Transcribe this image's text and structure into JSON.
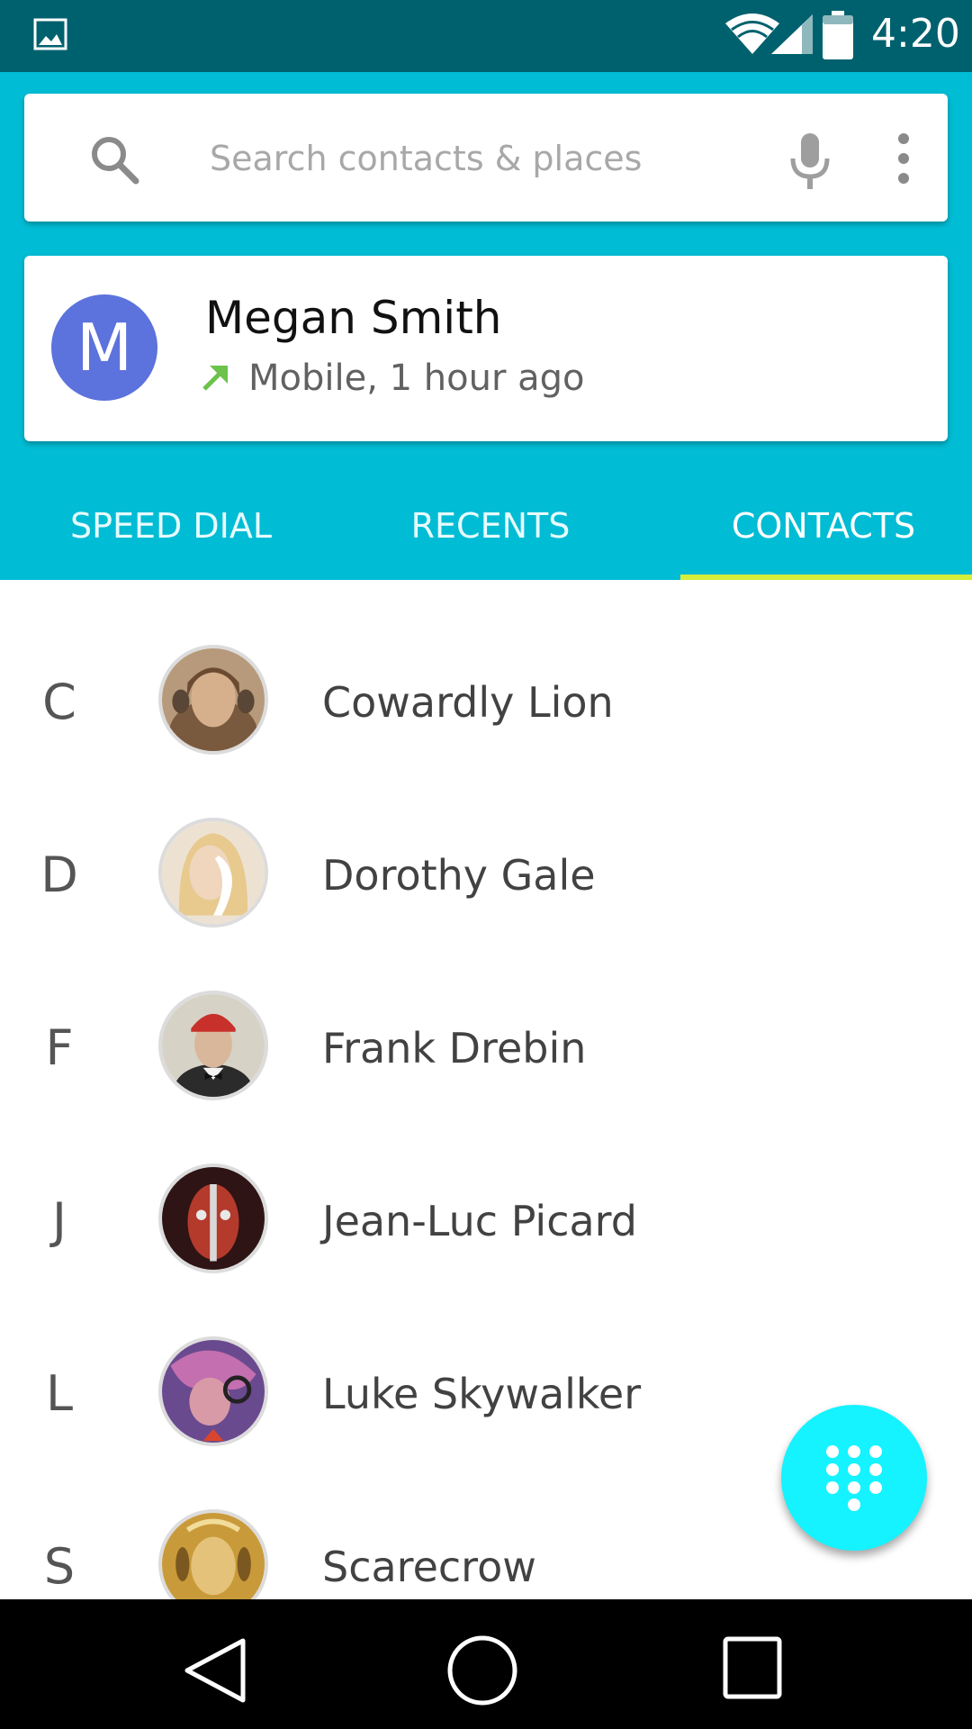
{
  "status_bar": {
    "time": "4:20",
    "icons": [
      "gallery-icon",
      "wifi-icon",
      "signal-icon",
      "battery-icon"
    ],
    "background": "#00616e"
  },
  "search": {
    "placeholder": "Search contacts & places",
    "icons": [
      "search-icon",
      "mic-icon",
      "more-vert-icon"
    ]
  },
  "recent_call": {
    "avatar_letter": "M",
    "avatar_color": "#5c72dc",
    "name": "Megan Smith",
    "detail": "Mobile, 1 hour ago",
    "call_type_icon": "outgoing-call-arrow-icon",
    "arrow_color": "#6cc24a"
  },
  "tabs": [
    {
      "label": "SPEED DIAL",
      "selected": false
    },
    {
      "label": "RECENTS",
      "selected": false
    },
    {
      "label": "CONTACTS",
      "selected": true
    }
  ],
  "contacts": [
    {
      "letter": "C",
      "name": "Cowardly Lion"
    },
    {
      "letter": "D",
      "name": "Dorothy Gale"
    },
    {
      "letter": "F",
      "name": "Frank Drebin"
    },
    {
      "letter": "J",
      "name": "Jean-Luc Picard"
    },
    {
      "letter": "L",
      "name": "Luke Skywalker"
    },
    {
      "letter": "S",
      "name": "Scarecrow"
    }
  ],
  "fab": {
    "icon": "dialpad-icon",
    "color": "#14f3ff"
  },
  "nav_bar": {
    "icons": [
      "back-icon",
      "home-icon",
      "recent-apps-icon"
    ]
  },
  "colors": {
    "header": "#00bcd4",
    "tab_indicator": "#d4ee3c"
  }
}
